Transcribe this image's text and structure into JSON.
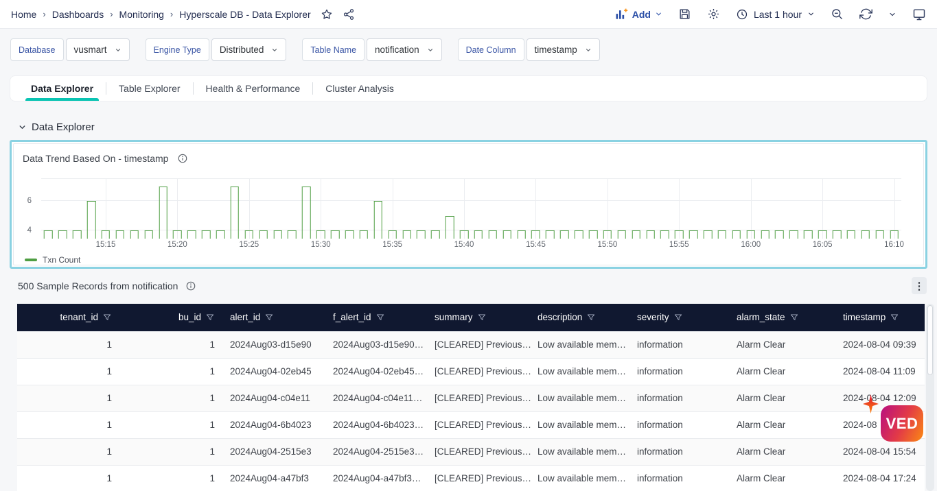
{
  "topbar": {
    "breadcrumb": [
      "Home",
      "Dashboards",
      "Monitoring",
      "Hyperscale DB - Data Explorer"
    ],
    "separator": "›",
    "add_label": "Add",
    "time_range": "Last 1 hour"
  },
  "filters": [
    {
      "label": "Database",
      "value": "vusmart"
    },
    {
      "label": "Engine Type",
      "value": "Distributed"
    },
    {
      "label": "Table Name",
      "value": "notification"
    },
    {
      "label": "Date Column",
      "value": "timestamp"
    }
  ],
  "tabs": [
    {
      "label": "Data Explorer",
      "active": true
    },
    {
      "label": "Table Explorer",
      "active": false
    },
    {
      "label": "Health & Performance",
      "active": false
    },
    {
      "label": "Cluster Analysis",
      "active": false
    }
  ],
  "section": {
    "title": "Data Explorer"
  },
  "chart_panel": {
    "title": "Data Trend Based On - timestamp"
  },
  "chart_data": {
    "type": "bar",
    "title": "Data Trend Based On - timestamp",
    "series": [
      {
        "name": "Txn Count",
        "color": "#4f9e43"
      }
    ],
    "x": [
      "15:11",
      "15:12",
      "15:13",
      "15:14",
      "15:15",
      "15:16",
      "15:17",
      "15:18",
      "15:19",
      "15:20",
      "15:21",
      "15:22",
      "15:23",
      "15:24",
      "15:25",
      "15:26",
      "15:27",
      "15:28",
      "15:29",
      "15:30",
      "15:31",
      "15:32",
      "15:33",
      "15:34",
      "15:35",
      "15:36",
      "15:37",
      "15:38",
      "15:39",
      "15:40",
      "15:41",
      "15:42",
      "15:43",
      "15:44",
      "15:45",
      "15:46",
      "15:47",
      "15:48",
      "15:49",
      "15:50",
      "15:51",
      "15:52",
      "15:53",
      "15:54",
      "15:55",
      "15:56",
      "15:57",
      "15:58",
      "15:59",
      "16:00",
      "16:01",
      "16:02",
      "16:03",
      "16:04",
      "16:05",
      "16:06",
      "16:07",
      "16:08",
      "16:09",
      "16:10"
    ],
    "values": [
      4,
      4,
      4,
      6,
      4,
      4,
      4,
      4,
      7,
      4,
      4,
      4,
      4,
      7,
      4,
      4,
      4,
      4,
      7,
      4,
      4,
      4,
      4,
      6,
      4,
      4,
      4,
      4,
      5,
      4,
      4,
      4,
      4,
      4,
      4,
      4,
      4,
      4,
      4,
      4,
      4,
      4,
      4,
      4,
      4,
      4,
      4,
      4,
      4,
      4,
      4,
      4,
      4,
      4,
      4,
      4,
      4,
      4,
      4,
      4
    ],
    "x_tick_labels": [
      "15:15",
      "15:20",
      "15:25",
      "15:30",
      "15:35",
      "15:40",
      "15:45",
      "15:50",
      "15:55",
      "16:00",
      "16:05",
      "16:10"
    ],
    "y_ticks": [
      4,
      6
    ],
    "ylim": [
      3.45,
      7.55
    ],
    "grid": true,
    "legend_position": "bottom-left",
    "xlabel": "",
    "ylabel": ""
  },
  "records": {
    "title": "500 Sample Records from notification",
    "columns": [
      "tenant_id",
      "bu_id",
      "alert_id",
      "f_alert_id",
      "summary",
      "description",
      "severity",
      "alarm_state",
      "timestamp"
    ],
    "rows": [
      [
        "1",
        "1",
        "2024Aug03-d15e90",
        "2024Aug03-d15e90…",
        "[CLEARED] Previous…",
        "Low available mem…",
        "information",
        "Alarm Clear",
        "2024-08-04 09:39"
      ],
      [
        "1",
        "1",
        "2024Aug04-02eb45",
        "2024Aug04-02eb45…",
        "[CLEARED] Previous…",
        "Low available mem…",
        "information",
        "Alarm Clear",
        "2024-08-04 11:09"
      ],
      [
        "1",
        "1",
        "2024Aug04-c04e11",
        "2024Aug04-c04e11…",
        "[CLEARED] Previous…",
        "Low available mem…",
        "information",
        "Alarm Clear",
        "2024-08-04 12:09"
      ],
      [
        "1",
        "1",
        "2024Aug04-6b4023",
        "2024Aug04-6b4023…",
        "[CLEARED] Previous…",
        "Low available mem…",
        "information",
        "Alarm Clear",
        "2024-08"
      ],
      [
        "1",
        "1",
        "2024Aug04-2515e3",
        "2024Aug04-2515e3…",
        "[CLEARED] Previous…",
        "Low available mem…",
        "information",
        "Alarm Clear",
        "2024-08-04 15:54"
      ],
      [
        "1",
        "1",
        "2024Aug04-a47bf3",
        "2024Aug04-a47bf3…",
        "[CLEARED] Previous…",
        "Low available mem…",
        "information",
        "Alarm Clear",
        "2024-08-04 17:24"
      ]
    ]
  },
  "watermark": {
    "logo_text": "VED"
  },
  "colors": {
    "accent_teal": "#0ac4b3",
    "bar_green": "#4f9e43",
    "table_header_navy": "#101830",
    "link_blue": "#2b4fa7",
    "filter_label_blue": "#3a55a5",
    "panel_highlight_cyan": "#8ad2e2",
    "add_plus_orange": "#f7941d"
  }
}
